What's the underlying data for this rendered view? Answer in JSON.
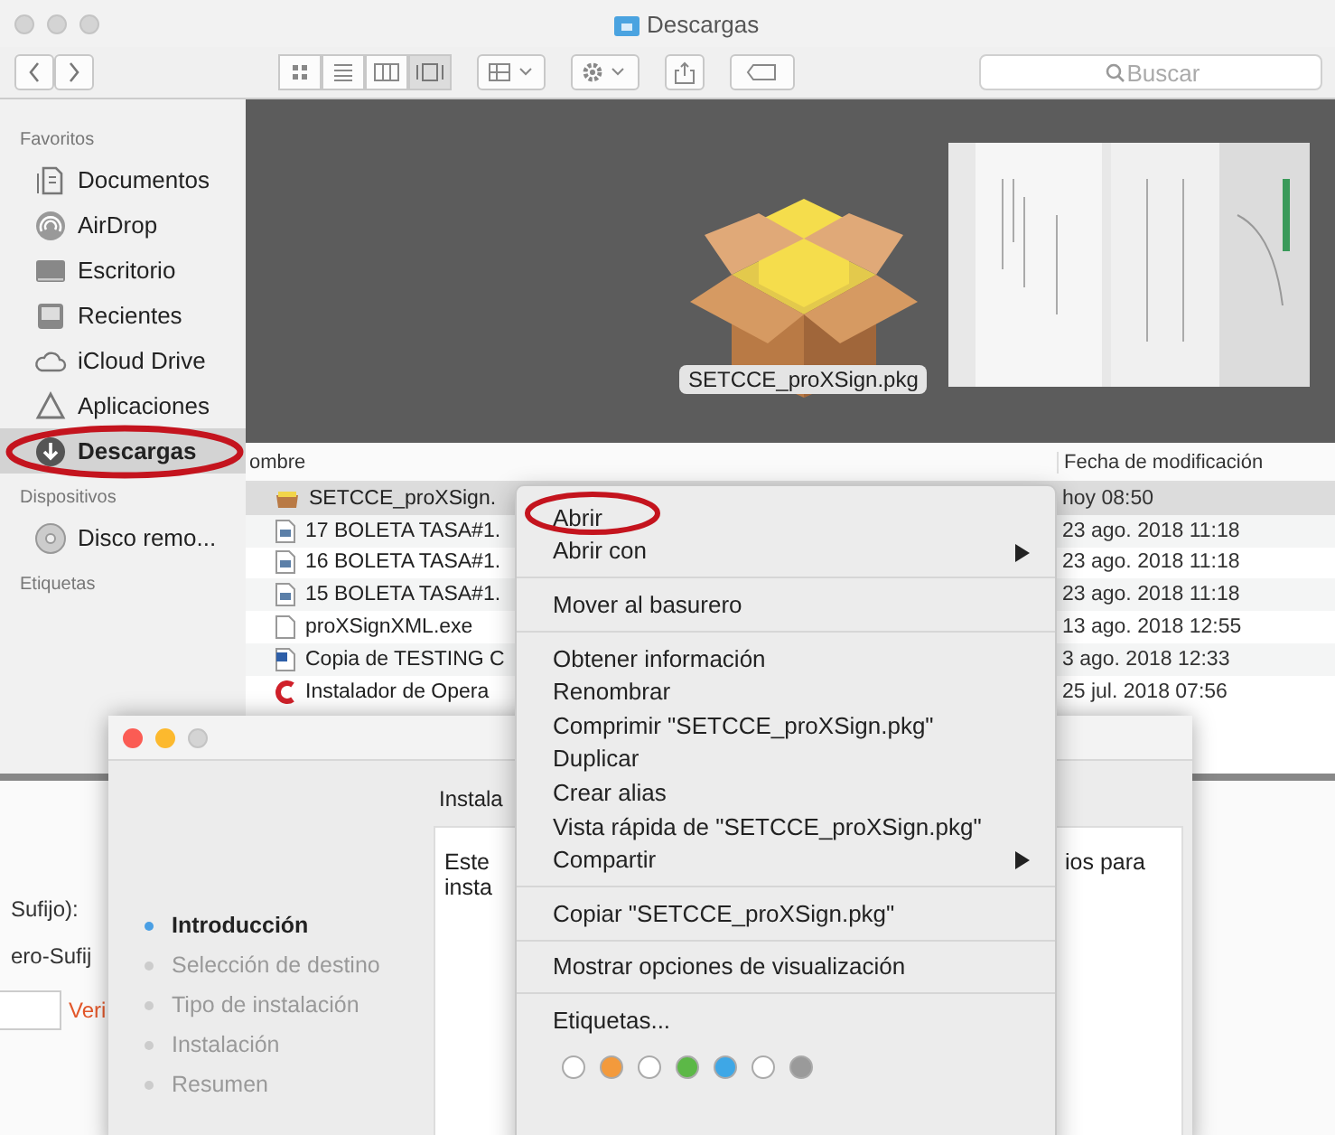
{
  "finder": {
    "title": "Descargas",
    "search": {
      "placeholder": "Buscar"
    },
    "sidebar": [
      {
        "heading": "Favoritos",
        "items": [
          {
            "label": "Documentos",
            "selected": false
          },
          {
            "label": "AirDrop",
            "selected": false
          },
          {
            "label": "Escritorio",
            "selected": false
          },
          {
            "label": "Recientes",
            "selected": false
          },
          {
            "label": "iCloud Drive",
            "selected": false
          },
          {
            "label": "Aplicaciones",
            "selected": false
          },
          {
            "label": "Descargas",
            "selected": true
          }
        ]
      },
      {
        "heading": "Dispositivos",
        "items": [
          {
            "label": "Disco remo...",
            "selected": false
          }
        ]
      },
      {
        "heading": "Etiquetas"
      }
    ],
    "preview": {
      "caption": "SETCCE_proXSign.pkg"
    },
    "columns": [
      "ombre",
      "Fecha de modificación"
    ],
    "rows": [
      {
        "name": "SETCCE_proXSign.",
        "date": "hoy 08:50",
        "selected": true
      },
      {
        "name": "17 BOLETA TASA#1.",
        "date": "23 ago. 2018 11:18",
        "selected": false
      },
      {
        "name": "16 BOLETA TASA#1.",
        "date": "23 ago. 2018 11:18",
        "selected": false
      },
      {
        "name": "15 BOLETA TASA#1.",
        "date": "23 ago. 2018 11:18",
        "selected": false
      },
      {
        "name": "proXSignXML.exe",
        "date": "13 ago. 2018 12:55",
        "selected": false
      },
      {
        "name": "Copia de TESTING C",
        "date": "3 ago. 2018 12:33",
        "selected": false
      },
      {
        "name": "Instalador de Opera",
        "date": "25 jul. 2018 07:56",
        "selected": false
      }
    ]
  },
  "webpage": {
    "labels": [
      "Sufijo):",
      "ero-Sufij"
    ],
    "link": "Veri"
  },
  "installer": {
    "heading": "Instala",
    "text_lines": [
      "Este",
      "insta"
    ],
    "text_right": "ios para",
    "steps": [
      {
        "label": "Introducción",
        "selected": true
      },
      {
        "label": "Selección de destino",
        "selected": false
      },
      {
        "label": "Tipo de instalación",
        "selected": false
      },
      {
        "label": "Instalación",
        "selected": false
      },
      {
        "label": "Resumen",
        "selected": false
      }
    ]
  },
  "context_menu": {
    "sections": [
      [
        {
          "label": "Abrir",
          "submenu": false
        },
        {
          "label": "Abrir con",
          "submenu": true
        }
      ],
      [
        {
          "label": "Mover al basurero",
          "submenu": false
        }
      ],
      [
        {
          "label": "Obtener información",
          "submenu": false
        },
        {
          "label": "Renombrar",
          "submenu": false
        },
        {
          "label": "Comprimir \"SETCCE_proXSign.pkg\"",
          "submenu": false
        },
        {
          "label": "Duplicar",
          "submenu": false
        },
        {
          "label": "Crear alias",
          "submenu": false
        },
        {
          "label": "Vista rápida de \"SETCCE_proXSign.pkg\"",
          "submenu": false
        },
        {
          "label": "Compartir",
          "submenu": true
        }
      ],
      [
        {
          "label": "Copiar \"SETCCE_proXSign.pkg\"",
          "submenu": false
        }
      ],
      [
        {
          "label": "Mostrar opciones de visualización",
          "submenu": false
        }
      ],
      [
        {
          "label": "Etiquetas...",
          "submenu": false
        }
      ]
    ],
    "tags": [
      {
        "color": "#ffffff"
      },
      {
        "color": "#f39a3c"
      },
      {
        "color": "#ffffff"
      },
      {
        "color": "#5cb847"
      },
      {
        "color": "#3ea7e6"
      },
      {
        "color": "#ffffff"
      },
      {
        "color": "#9a9a9a"
      }
    ]
  }
}
